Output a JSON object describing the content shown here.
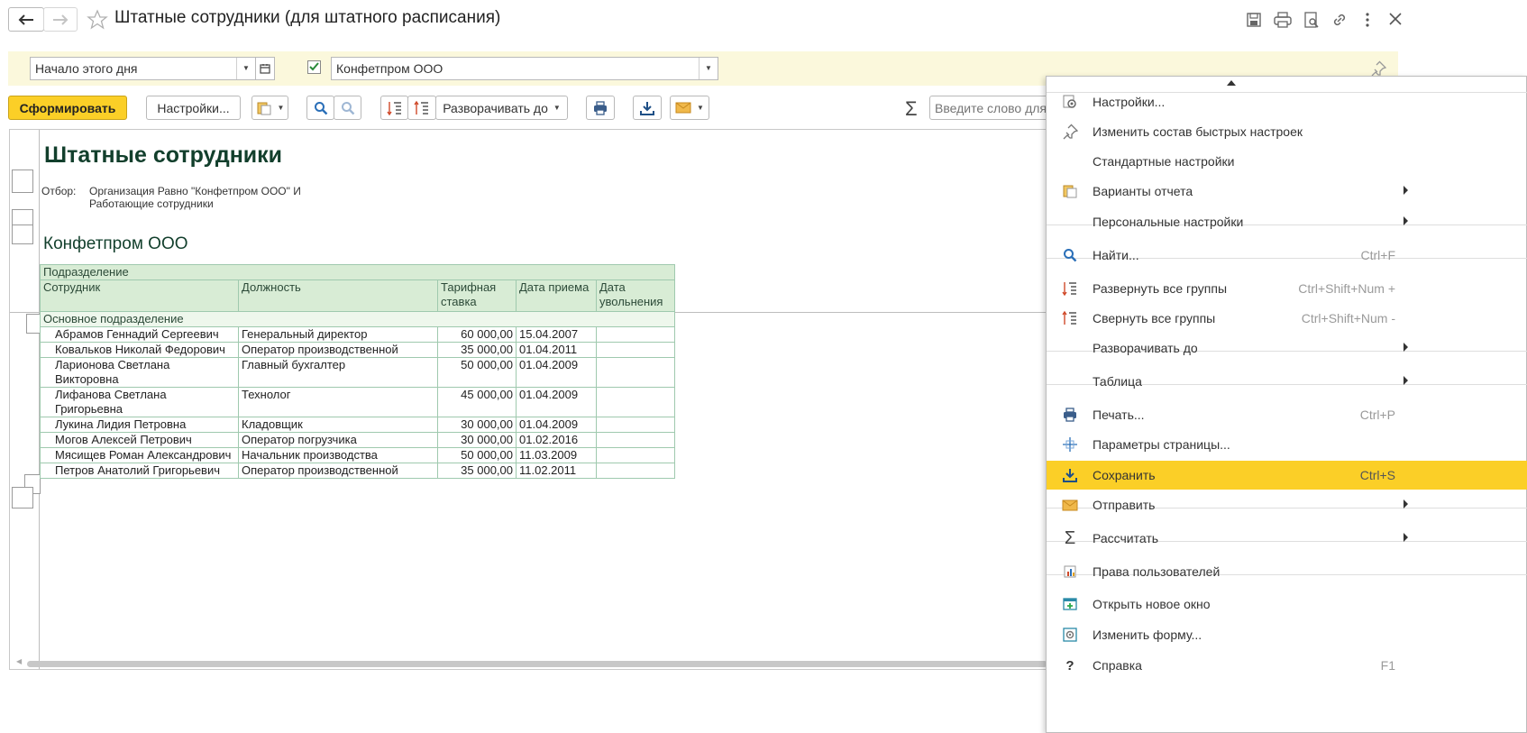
{
  "window": {
    "title": "Штатные сотрудники (для штатного расписания)"
  },
  "filter": {
    "period_value": "Начало этого дня",
    "org_value": "Конфетпром ООО",
    "org_checked": true
  },
  "toolbar": {
    "generate_label": "Сформировать",
    "settings_label": "Настройки...",
    "expand_to_label": "Разворачивать до",
    "search_placeholder": "Введите слово для"
  },
  "report": {
    "title": "Штатные сотрудники",
    "filter_label": "Отбор:",
    "filter_line1": "Организация Равно \"Конфетпром ООО\" И",
    "filter_line2": "Работающие сотрудники",
    "org_heading": "Конфетпром ООО",
    "header": {
      "department": "Подразделение",
      "employee": "Сотрудник",
      "position": "Должность",
      "rate_line1": "Тарифная",
      "rate_line2": "ставка",
      "hire_date": "Дата приема",
      "dismiss_line1": "Дата",
      "dismiss_line2": "увольнения"
    },
    "group_name": "Основное подразделение",
    "rows": [
      {
        "employee": "Абрамов Геннадий Сергеевич",
        "position": "Генеральный директор",
        "rate": "60 000,00",
        "hire": "15.04.2007",
        "dismiss": ""
      },
      {
        "employee": "Ковальков Николай Федорович",
        "position": "Оператор производственной",
        "rate": "35 000,00",
        "hire": "01.04.2011",
        "dismiss": ""
      },
      {
        "employee": "Ларионова Светлана Викторовна",
        "position": "Главный бухгалтер",
        "rate": "50 000,00",
        "hire": "01.04.2009",
        "dismiss": ""
      },
      {
        "employee": "Лифанова Светлана Григорьевна",
        "position": "Технолог",
        "rate": "45 000,00",
        "hire": "01.04.2009",
        "dismiss": ""
      },
      {
        "employee": "Лукина Лидия Петровна",
        "position": "Кладовщик",
        "rate": "30 000,00",
        "hire": "01.04.2009",
        "dismiss": ""
      },
      {
        "employee": "Могов Алексей Петрович",
        "position": "Оператор погрузчика",
        "rate": "30 000,00",
        "hire": "01.02.2016",
        "dismiss": ""
      },
      {
        "employee": "Мясищев Роман Александрович",
        "position": "Начальник производства",
        "rate": "50 000,00",
        "hire": "11.03.2009",
        "dismiss": ""
      },
      {
        "employee": "Петров Анатолий Григорьевич",
        "position": "Оператор производственной",
        "rate": "35 000,00",
        "hire": "11.02.2011",
        "dismiss": ""
      }
    ]
  },
  "menu": {
    "items": [
      {
        "label": "Настройки...",
        "shortcut": "",
        "icon": "settings-gear-icon",
        "submenu": false
      },
      {
        "label": "Изменить состав быстрых настроек",
        "shortcut": "",
        "icon": "pin-icon",
        "submenu": false
      },
      {
        "label": "Стандартные настройки",
        "shortcut": "",
        "icon": "",
        "submenu": false
      },
      {
        "label": "Варианты отчета",
        "shortcut": "",
        "icon": "report-variants-icon",
        "submenu": true
      },
      {
        "label": "Персональные настройки",
        "shortcut": "",
        "icon": "",
        "submenu": true
      },
      {
        "label": "Найти...",
        "shortcut": "Ctrl+F",
        "icon": "search-icon",
        "submenu": false
      },
      {
        "label": "Развернуть все группы",
        "shortcut": "Ctrl+Shift+Num +",
        "icon": "expand-groups-icon",
        "submenu": false
      },
      {
        "label": "Свернуть все группы",
        "shortcut": "Ctrl+Shift+Num -",
        "icon": "collapse-groups-icon",
        "submenu": false
      },
      {
        "label": "Разворачивать до",
        "shortcut": "",
        "icon": "",
        "submenu": true
      },
      {
        "label": "Таблица",
        "shortcut": "",
        "icon": "",
        "submenu": true
      },
      {
        "label": "Печать...",
        "shortcut": "Ctrl+P",
        "icon": "printer-icon",
        "submenu": false
      },
      {
        "label": "Параметры страницы...",
        "shortcut": "",
        "icon": "page-setup-icon",
        "submenu": false
      },
      {
        "label": "Сохранить",
        "shortcut": "Ctrl+S",
        "icon": "save-download-icon",
        "submenu": false
      },
      {
        "label": "Отправить",
        "shortcut": "",
        "icon": "envelope-icon",
        "submenu": true
      },
      {
        "label": "Рассчитать",
        "shortcut": "",
        "icon": "sigma-icon",
        "submenu": true
      },
      {
        "label": "Права пользователей",
        "shortcut": "",
        "icon": "user-rights-icon",
        "submenu": false
      },
      {
        "label": "Открыть новое окно",
        "shortcut": "",
        "icon": "new-window-icon",
        "submenu": false
      },
      {
        "label": "Изменить форму...",
        "shortcut": "",
        "icon": "change-form-icon",
        "submenu": false
      },
      {
        "label": "Справка",
        "shortcut": "F1",
        "icon": "help-icon",
        "submenu": false
      }
    ]
  },
  "colors": {
    "accent": "#fbcf27",
    "filterbar_bg": "#fbf8dc",
    "report_header_bg": "#d8ecd5",
    "report_title": "#123f2c"
  }
}
